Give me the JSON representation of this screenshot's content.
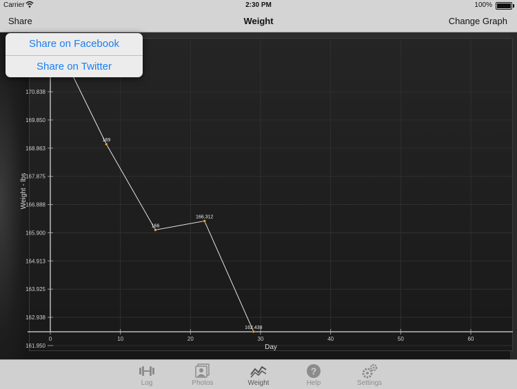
{
  "status_bar": {
    "carrier": "Carrier",
    "time": "2:30 PM",
    "battery_percent": "100%",
    "battery_level": 1.0
  },
  "nav": {
    "share_label": "Share",
    "title": "Weight",
    "change_graph_label": "Change Graph"
  },
  "share_menu": {
    "items": [
      "Share on Facebook",
      "Share on Twitter"
    ]
  },
  "chart_data": {
    "type": "line",
    "xlabel": "Day",
    "ylabel": "Weight - lbs",
    "xlim": [
      0,
      66
    ],
    "ylim": [
      161.95,
      171.825
    ],
    "x_ticks": [
      "0",
      "10",
      "20",
      "30",
      "40",
      "50",
      "60"
    ],
    "y_ticks": [
      "161.950",
      "162.938",
      "163.925",
      "164.913",
      "165.900",
      "166.888",
      "167.875",
      "168.863",
      "169.850",
      "170.838"
    ],
    "points": [
      {
        "x": 1,
        "y": 172.5,
        "label": ""
      },
      {
        "x": 8,
        "y": 169,
        "label": "169"
      },
      {
        "x": 15,
        "y": 166,
        "label": "166"
      },
      {
        "x": 22,
        "y": 166.312,
        "label": "166.312"
      },
      {
        "x": 29,
        "y": 162.438,
        "label": "162.438"
      }
    ],
    "line_color": "#e6e6e6",
    "point_color": "#f0a030",
    "grid": true
  },
  "tabs": [
    {
      "label": "Log",
      "icon": "dumbbell-icon",
      "active": false
    },
    {
      "label": "Photos",
      "icon": "photos-icon",
      "active": false
    },
    {
      "label": "Weight",
      "icon": "graph-icon",
      "active": true
    },
    {
      "label": "Help",
      "icon": "help-icon",
      "active": false
    },
    {
      "label": "Settings",
      "icon": "gears-icon",
      "active": false
    }
  ]
}
